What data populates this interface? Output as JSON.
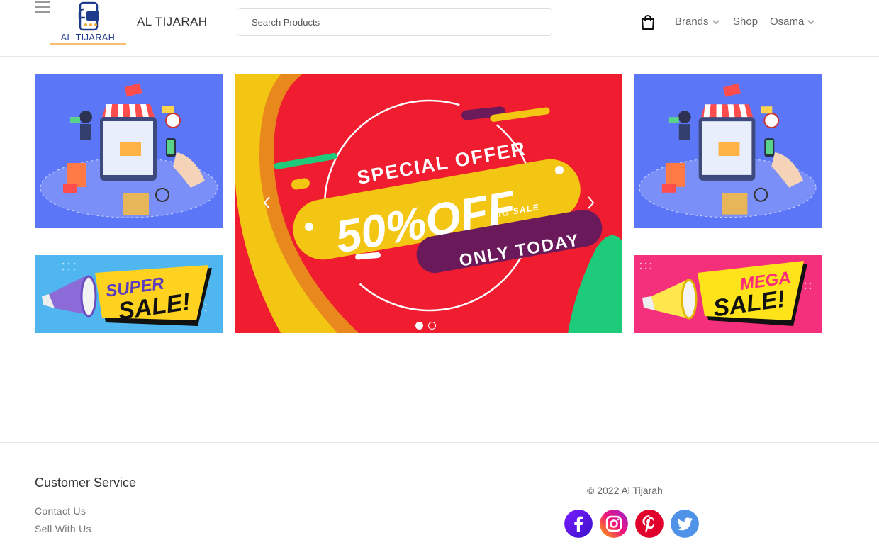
{
  "header": {
    "logo_text": "AL-TIJARAH",
    "brand_name": "AL TIJARAH",
    "search_placeholder": "Search Products",
    "nav": {
      "brands": "Brands",
      "shop": "Shop",
      "user": "Osama"
    },
    "icons": [
      "menu-icon",
      "cart-bag-icon",
      "chevron-down-icon"
    ]
  },
  "hero": {
    "carousel": {
      "line1": "SPECIAL OFFER",
      "line2": "50%OFF",
      "line3": "BIG SALE",
      "line4": "ONLY TODAY",
      "slides": 2,
      "active_slide": 1
    },
    "banner_left": {
      "word1": "SUPER",
      "word2": "SALE!"
    },
    "banner_right": {
      "word1": "MEGA",
      "word2": "SALE!"
    },
    "colors": {
      "carousel_bg": "#ef1d2f",
      "tile_blue": "#5b77f7",
      "banner_left_bg": "#4fb6f0",
      "banner_right_bg": "#f42f7c",
      "yellow": "#f3c614",
      "purple": "#6a1a5b"
    }
  },
  "footer": {
    "title": "Customer Service",
    "links": [
      "Contact Us",
      "Sell With Us"
    ],
    "copyright": "© 2022 Al Tijarah",
    "social": [
      "facebook-icon",
      "instagram-icon",
      "pinterest-icon",
      "twitter-icon"
    ]
  }
}
